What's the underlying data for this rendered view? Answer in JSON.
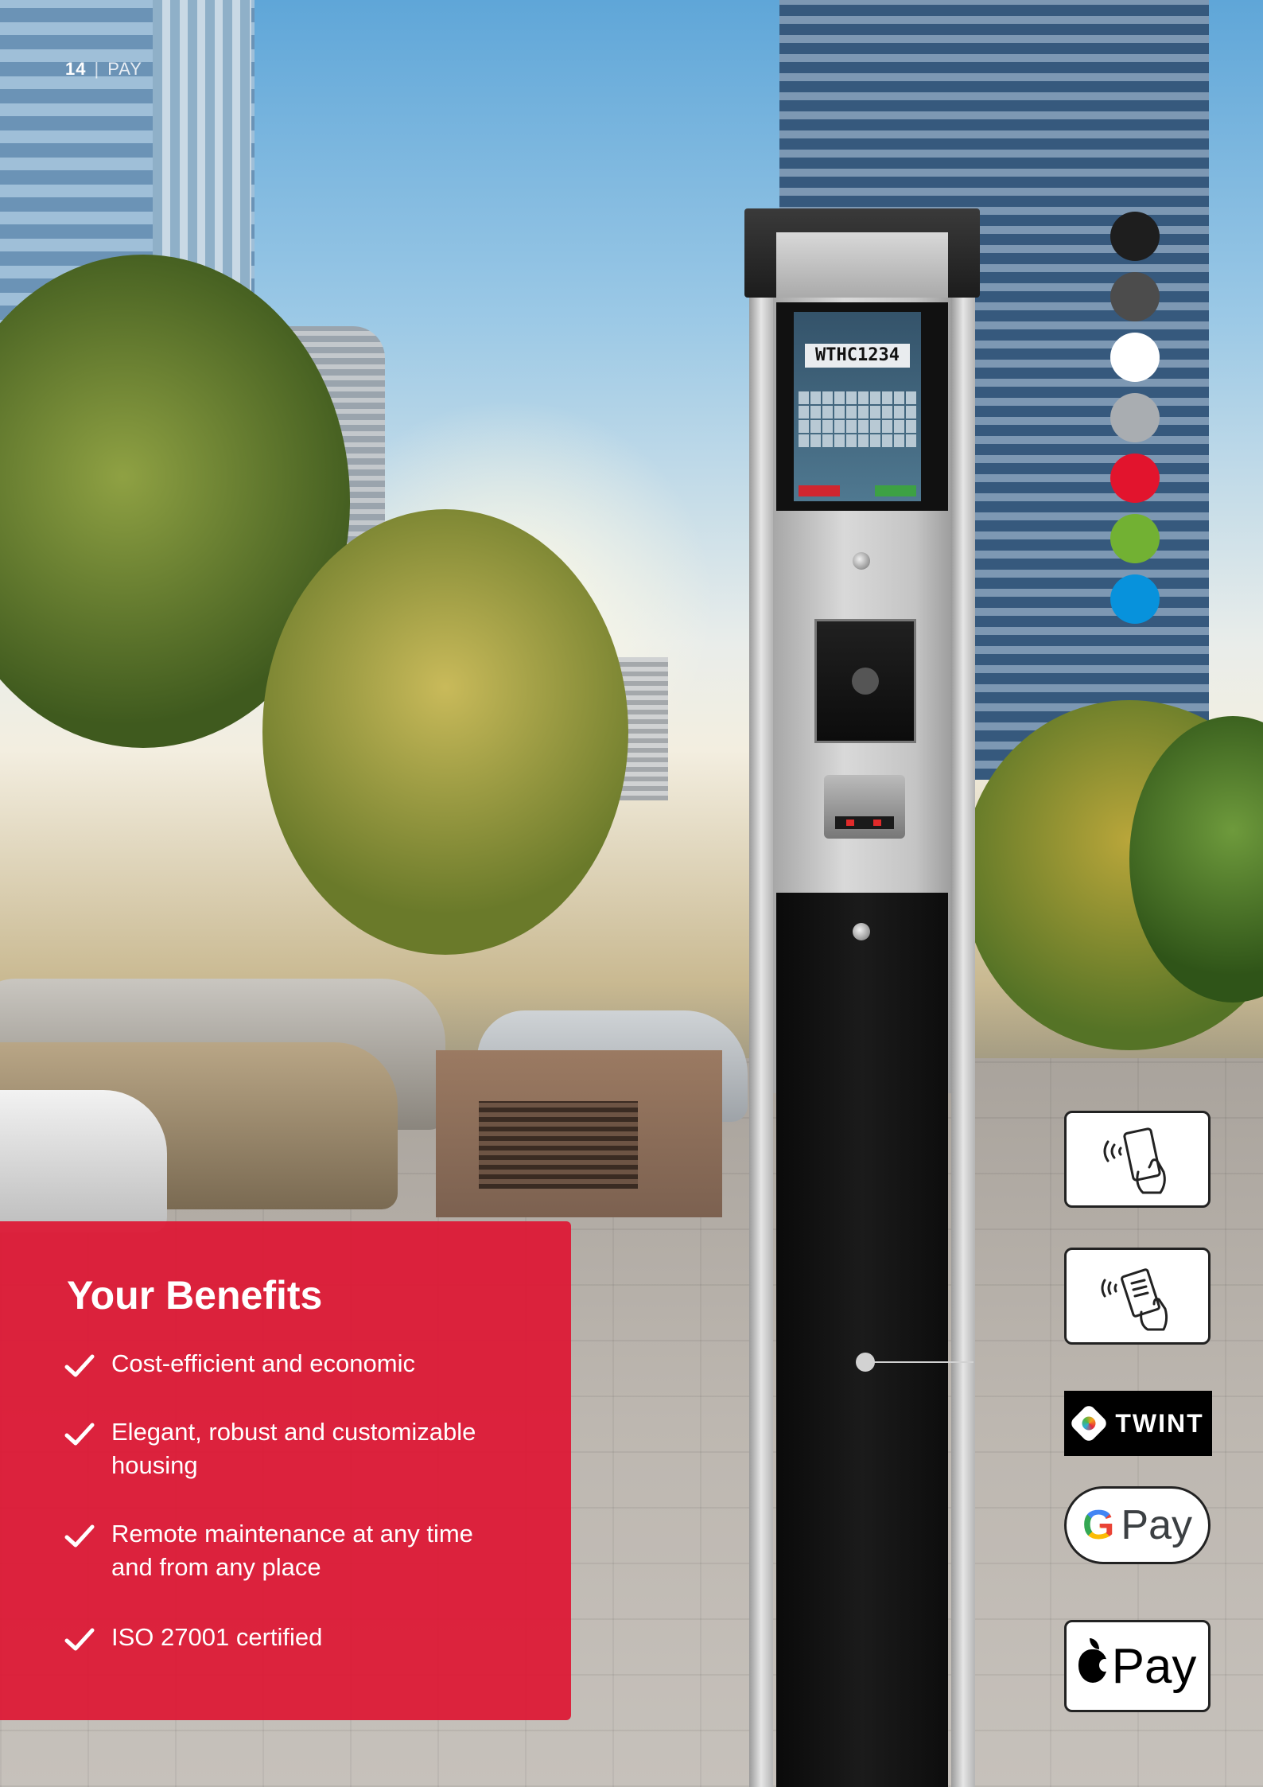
{
  "header": {
    "page_number": "14",
    "separator": "|",
    "section": "PAY"
  },
  "kiosk": {
    "screen_plate": "WTHC1234",
    "keys": [
      "0",
      "1",
      "2",
      "3",
      "4",
      "5",
      "6",
      "7",
      "8",
      "9",
      "A",
      "B",
      "C",
      "D",
      "E",
      "F",
      "G",
      "H",
      "I",
      "J",
      "K",
      "L",
      "M",
      "N",
      "O",
      "P",
      "Q",
      "R",
      "S",
      "",
      "",
      "",
      "",
      "T",
      "U",
      "V",
      "W",
      "X",
      "Y",
      "Z"
    ]
  },
  "color_options": [
    "#1e1e1e",
    "#4c4c4c",
    "#ffffff",
    "#a9adb1",
    "#e2142d",
    "#72b133",
    "#0792dc"
  ],
  "payment_methods": {
    "icons": [
      "nfc-phone-icon",
      "contactless-card-icon"
    ],
    "twint_label": "TWINT",
    "gpay_g": "G",
    "gpay_label": "Pay",
    "applepay_label": "Pay"
  },
  "benefits": {
    "title": "Your Benefits",
    "items": [
      [
        "Cost-efficient and economic"
      ],
      [
        "Elegant, robust and  customizable",
        "housing"
      ],
      [
        "Remote maintenance at any time",
        "and from any place"
      ],
      [
        "ISO 27001 certified"
      ]
    ]
  },
  "colors": {
    "accent_red": "#de1734"
  }
}
